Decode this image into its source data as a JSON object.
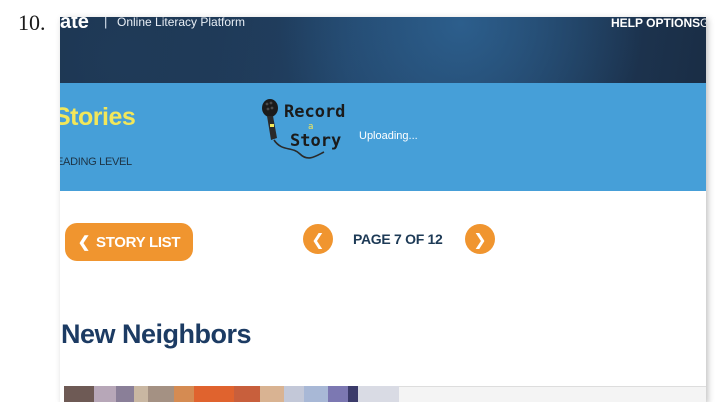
{
  "list_number": "10.",
  "header": {
    "logo_fragment": "ate",
    "divider": "|",
    "platform_name": "Online Literacy Platform",
    "help_options": "HELP OPTIONS",
    "help_icon_fragment": "G"
  },
  "section": {
    "title": "Stories",
    "reading_level_label": "EADING LEVEL"
  },
  "record_a_story": {
    "line1": "Record",
    "line2": "a",
    "line3": "Story",
    "status": "Uploading..."
  },
  "navigation": {
    "story_list_chevron": "❮",
    "story_list_label": "STORY LIST",
    "prev_symbol": "❮",
    "next_symbol": "❯",
    "page_indicator": "PAGE 7 OF 12",
    "current_page": 7,
    "total_pages": 12
  },
  "story": {
    "title": "New Neighbors"
  },
  "colors": {
    "accent_orange": "#f0952f",
    "band_blue": "#469fd8",
    "title_yellow": "#f2e75a",
    "title_navy": "#1c3b63",
    "header_dark": "#1f3c5c"
  }
}
